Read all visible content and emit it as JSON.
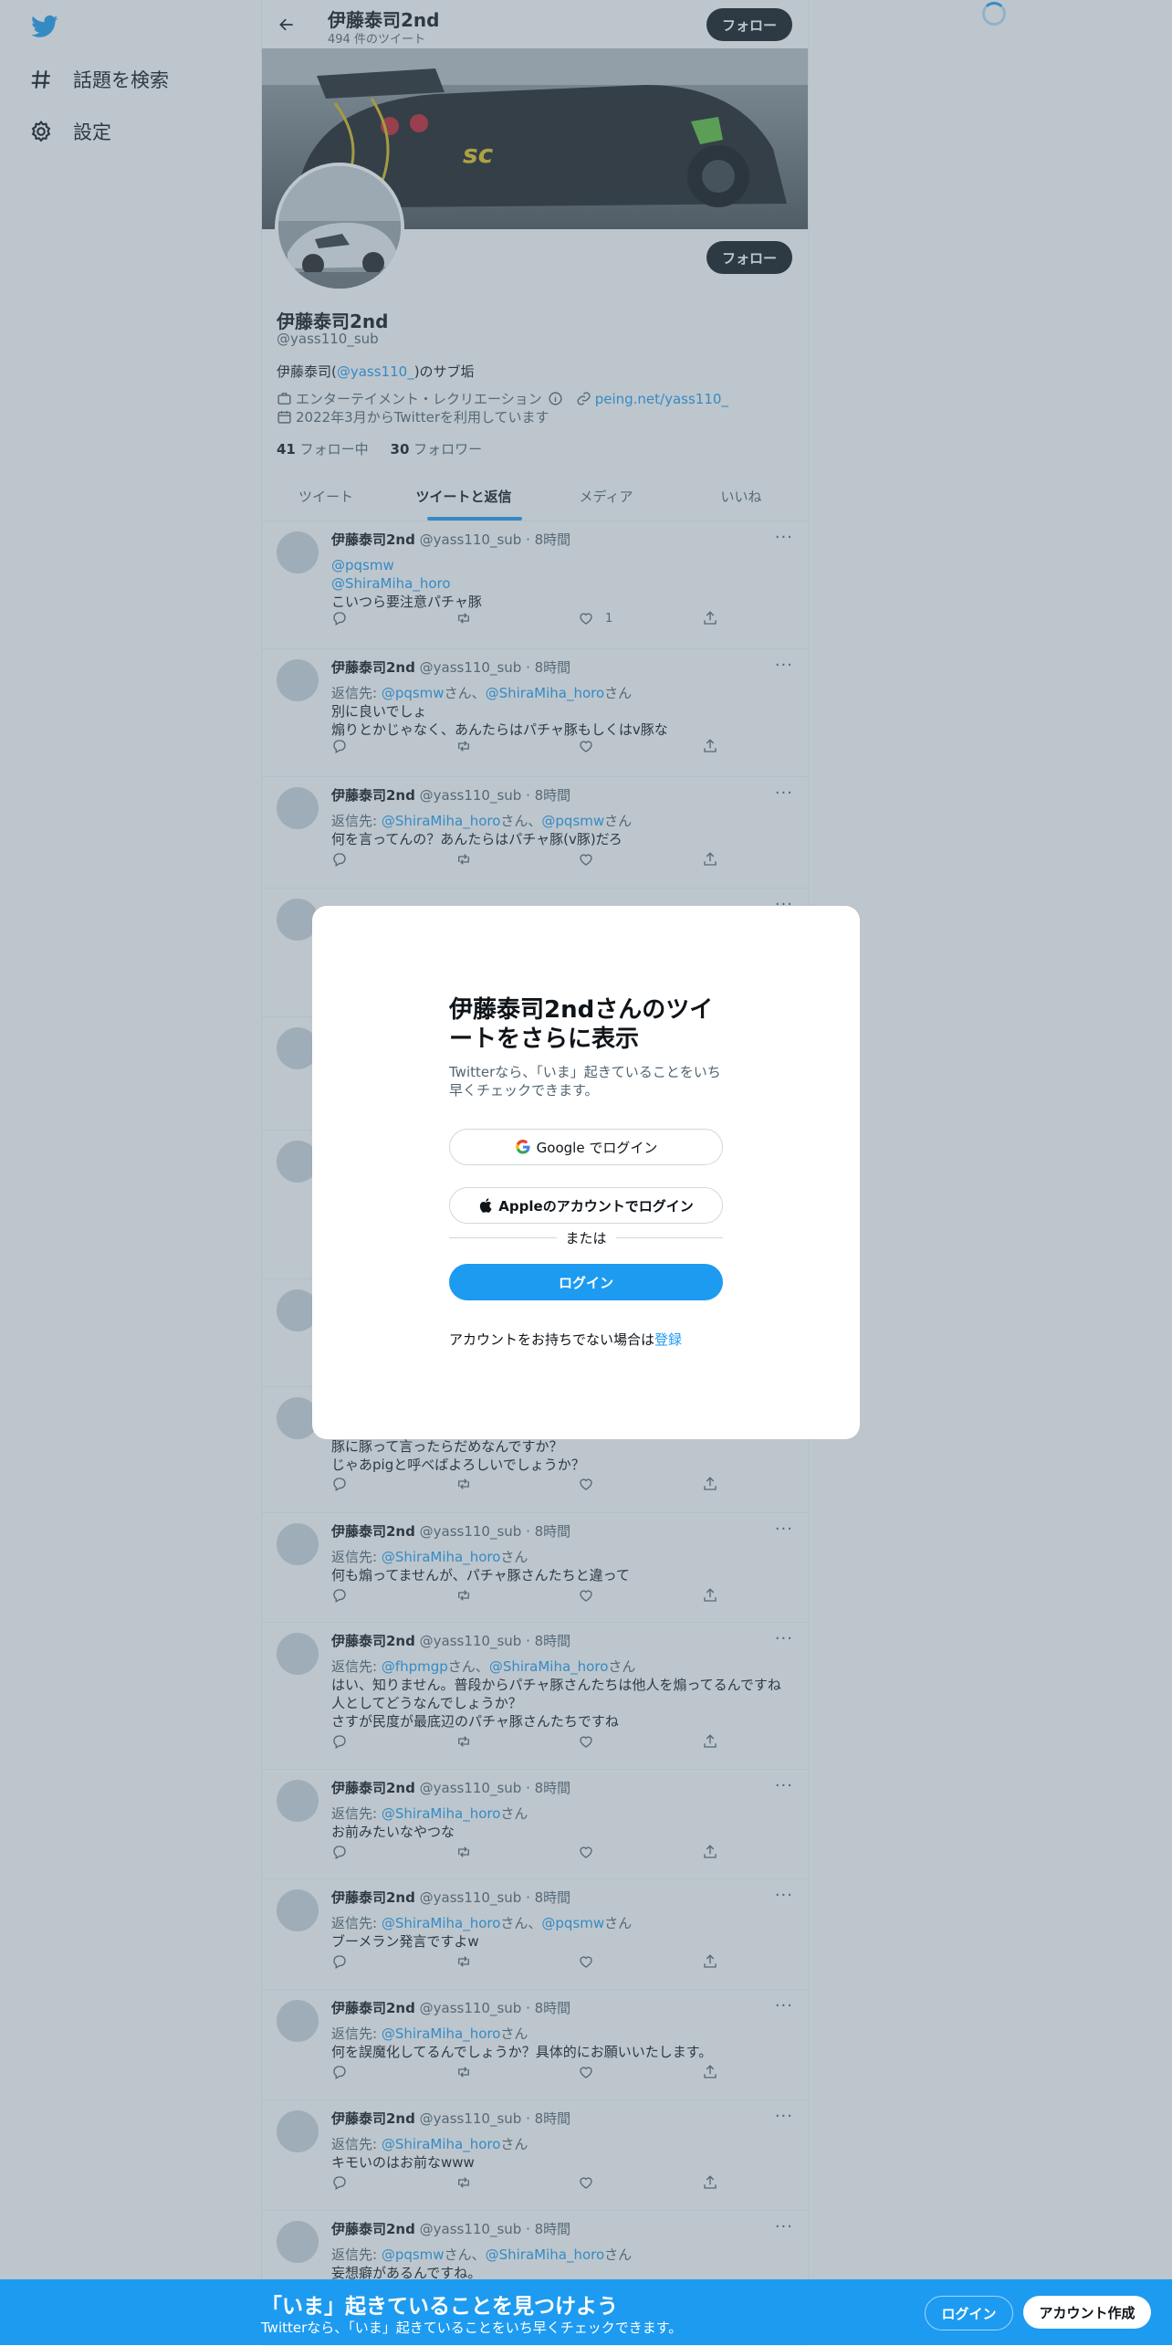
{
  "colors": {
    "accent": "#1d9bf0",
    "text": "#0f1419",
    "muted": "#536471",
    "overlay": "rgba(91,112,131,0.4)"
  },
  "sidebar": {
    "logo": "twitter-bird-icon",
    "items": [
      {
        "label": "話題を検索",
        "icon": "hashtag-icon"
      },
      {
        "label": "設定",
        "icon": "gear-icon"
      }
    ]
  },
  "header": {
    "name": "伊藤泰司2nd",
    "tweet_count": "494 件のツイート",
    "follow_label": "フォロー"
  },
  "profile": {
    "name": "伊藤泰司2nd",
    "handle": "@yass110_sub",
    "follow_label": "フォロー",
    "bio_prefix": "伊藤泰司(",
    "bio_link": "@yass110_",
    "bio_suffix": ")のサブ垢",
    "category": "エンターテイメント・レクリエーション",
    "website": "peing.net/yass110_",
    "joined": "2022年3月からTwitterを利用しています",
    "following_count": "41",
    "following_label": "フォロー中",
    "followers_count": "30",
    "followers_label": "フォロワー"
  },
  "tabs": [
    {
      "label": "ツイート",
      "active": false
    },
    {
      "label": "ツイートと返信",
      "active": true
    },
    {
      "label": "メディア",
      "active": false
    },
    {
      "label": "いいね",
      "active": false
    }
  ],
  "tweets": [
    {
      "name": "伊藤泰司2nd",
      "meta": "@yass110_sub · 8時間",
      "lines": [
        {
          "parts": [
            {
              "t": "@pqsmw",
              "link": true
            }
          ]
        },
        {
          "parts": [
            {
              "t": "@ShiraMiha_horo",
              "link": true
            }
          ]
        },
        {
          "parts": [
            {
              "t": "こいつら要注意パチャ豚"
            }
          ]
        }
      ],
      "likes": "1"
    },
    {
      "name": "伊藤泰司2nd",
      "meta": "@yass110_sub · 8時間",
      "lines": [
        {
          "parts": [
            {
              "t": "返信先: ",
              "muted": true
            },
            {
              "t": "@pqsmw",
              "link": true
            },
            {
              "t": "さん、",
              "muted": true
            },
            {
              "t": "@ShiraMiha_horo",
              "link": true
            },
            {
              "t": "さん",
              "muted": true
            }
          ]
        },
        {
          "parts": [
            {
              "t": "別に良いでしょ"
            }
          ]
        },
        {
          "parts": [
            {
              "t": "煽りとかじゃなく、あんたらはパチャ豚もしくはv豚な"
            }
          ]
        }
      ],
      "likes": ""
    },
    {
      "name": "伊藤泰司2nd",
      "meta": "@yass110_sub · 8時間",
      "lines": [
        {
          "parts": [
            {
              "t": "返信先: ",
              "muted": true
            },
            {
              "t": "@ShiraMiha_horo",
              "link": true
            },
            {
              "t": "さん、",
              "muted": true
            },
            {
              "t": "@pqsmw",
              "link": true
            },
            {
              "t": "さん",
              "muted": true
            }
          ]
        },
        {
          "parts": [
            {
              "t": "何を言ってんの？あんたらはパチャ豚(v豚)だろ"
            }
          ]
        }
      ],
      "likes": ""
    },
    {
      "name": "",
      "meta": "",
      "lines": [],
      "likes": ""
    },
    {
      "name": "",
      "meta": "",
      "lines": [],
      "likes": ""
    },
    {
      "name": "",
      "meta": "",
      "lines": [],
      "likes": ""
    },
    {
      "name": "",
      "meta": "",
      "lines": [],
      "likes": ""
    },
    {
      "name": "",
      "meta": "",
      "lines": [
        {
          "parts": [
            {
              "t": "豚に豚って言ったらだめなんですか？"
            }
          ]
        },
        {
          "parts": [
            {
              "t": "じゃあpigと呼べばよろしいでしょうか？"
            }
          ]
        }
      ],
      "likes": ""
    },
    {
      "name": "伊藤泰司2nd",
      "meta": "@yass110_sub · 8時間",
      "lines": [
        {
          "parts": [
            {
              "t": "返信先: ",
              "muted": true
            },
            {
              "t": "@ShiraMiha_horo",
              "link": true
            },
            {
              "t": "さん",
              "muted": true
            }
          ]
        },
        {
          "parts": [
            {
              "t": "何も煽ってませんが、パチャ豚さんたちと違って"
            }
          ]
        }
      ],
      "likes": ""
    },
    {
      "name": "伊藤泰司2nd",
      "meta": "@yass110_sub · 8時間",
      "lines": [
        {
          "parts": [
            {
              "t": "返信先: ",
              "muted": true
            },
            {
              "t": "@fhpmgp",
              "link": true
            },
            {
              "t": "さん、",
              "muted": true
            },
            {
              "t": "@ShiraMiha_horo",
              "link": true
            },
            {
              "t": "さん",
              "muted": true
            }
          ]
        },
        {
          "parts": [
            {
              "t": "はい、知りません。普段からパチャ豚さんたちは他人を煽ってるんですね"
            }
          ]
        },
        {
          "parts": [
            {
              "t": "人としてどうなんでしょうか？"
            }
          ]
        },
        {
          "parts": [
            {
              "t": "さすが民度が最底辺のパチャ豚さんたちですね"
            }
          ]
        }
      ],
      "likes": ""
    },
    {
      "name": "伊藤泰司2nd",
      "meta": "@yass110_sub · 8時間",
      "lines": [
        {
          "parts": [
            {
              "t": "返信先: ",
              "muted": true
            },
            {
              "t": "@ShiraMiha_horo",
              "link": true
            },
            {
              "t": "さん",
              "muted": true
            }
          ]
        },
        {
          "parts": [
            {
              "t": "お前みたいなやつな"
            }
          ]
        }
      ],
      "likes": ""
    },
    {
      "name": "伊藤泰司2nd",
      "meta": "@yass110_sub · 8時間",
      "lines": [
        {
          "parts": [
            {
              "t": "返信先: ",
              "muted": true
            },
            {
              "t": "@ShiraMiha_horo",
              "link": true
            },
            {
              "t": "さん、",
              "muted": true
            },
            {
              "t": "@pqsmw",
              "link": true
            },
            {
              "t": "さん",
              "muted": true
            }
          ]
        },
        {
          "parts": [
            {
              "t": "ブーメラン発言ですよw"
            }
          ]
        }
      ],
      "likes": ""
    },
    {
      "name": "伊藤泰司2nd",
      "meta": "@yass110_sub · 8時間",
      "lines": [
        {
          "parts": [
            {
              "t": "返信先: ",
              "muted": true
            },
            {
              "t": "@ShiraMiha_horo",
              "link": true
            },
            {
              "t": "さん",
              "muted": true
            }
          ]
        },
        {
          "parts": [
            {
              "t": "何を誤魔化してるんでしょうか？具体的にお願いいたします。"
            }
          ]
        }
      ],
      "likes": ""
    },
    {
      "name": "伊藤泰司2nd",
      "meta": "@yass110_sub · 8時間",
      "lines": [
        {
          "parts": [
            {
              "t": "返信先: ",
              "muted": true
            },
            {
              "t": "@ShiraMiha_horo",
              "link": true
            },
            {
              "t": "さん",
              "muted": true
            }
          ]
        },
        {
          "parts": [
            {
              "t": "キモいのはお前なwww"
            }
          ]
        }
      ],
      "likes": ""
    },
    {
      "name": "伊藤泰司2nd",
      "meta": "@yass110_sub · 8時間",
      "lines": [
        {
          "parts": [
            {
              "t": "返信先: ",
              "muted": true
            },
            {
              "t": "@pqsmw",
              "link": true
            },
            {
              "t": "さん、",
              "muted": true
            },
            {
              "t": "@ShiraMiha_horo",
              "link": true
            },
            {
              "t": "さん",
              "muted": true
            }
          ]
        },
        {
          "parts": [
            {
              "t": "妄想癖があるんですね。"
            }
          ]
        }
      ],
      "likes": ""
    }
  ],
  "modal": {
    "title": "伊藤泰司2ndさんのツイートをさらに表示",
    "subtitle": "Twitterなら、「いま」起きていることをいち早くチェックできます。",
    "google_label": "Google でログイン",
    "apple_label": "Appleのアカウントでログイン",
    "or_label": "または",
    "login_label": "ログイン",
    "signup_prompt": "アカウントをお持ちでない場合は",
    "signup_link": "登録"
  },
  "bottom_bar": {
    "title": "「いま」起きていることを見つけよう",
    "subtitle": "Twitterなら、「いま」起きていることをいち早くチェックできます。",
    "login_label": "ログイン",
    "signup_label": "アカウント作成"
  }
}
